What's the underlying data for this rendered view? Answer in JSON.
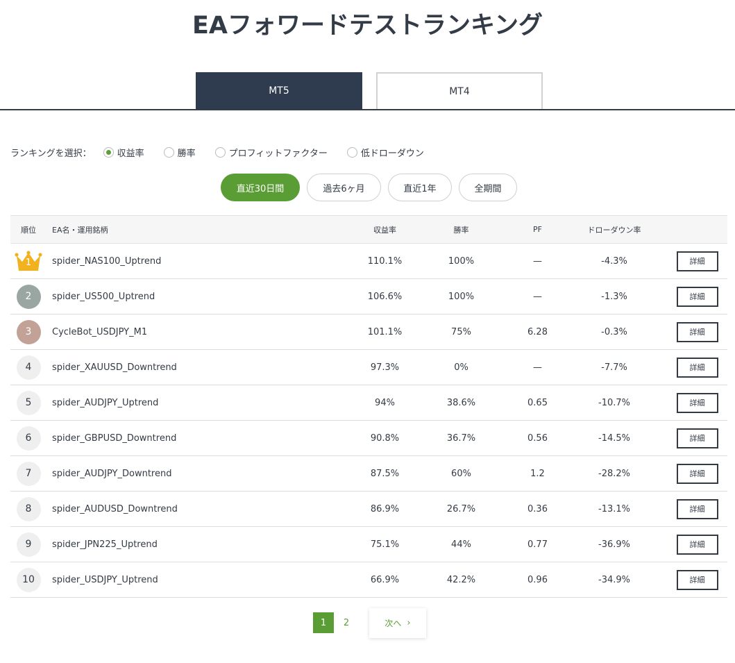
{
  "title": "EAフォワードテストランキング",
  "platform_tabs": [
    {
      "label": "MT5",
      "active": true
    },
    {
      "label": "MT4",
      "active": false
    }
  ],
  "ranking_select": {
    "label": "ランキングを選択：",
    "options": [
      {
        "label": "収益率",
        "checked": true
      },
      {
        "label": "勝率",
        "checked": false
      },
      {
        "label": "プロフィットファクター",
        "checked": false
      },
      {
        "label": "低ドローダウン",
        "checked": false
      }
    ]
  },
  "periods": [
    {
      "label": "直近30日間",
      "active": true
    },
    {
      "label": "過去6ヶ月",
      "active": false
    },
    {
      "label": "直近1年",
      "active": false
    },
    {
      "label": "全期間",
      "active": false
    }
  ],
  "table": {
    "headers": {
      "rank": "順位",
      "name": "EA名・運用銘柄",
      "return": "収益率",
      "win": "勝率",
      "pf": "PF",
      "drawdown": "ドローダウン率"
    },
    "detail_label": "詳細",
    "rows": [
      {
        "rank": "1",
        "name": "spider_NAS100_Uptrend",
        "return": "110.1%",
        "win": "100%",
        "pf": "—",
        "drawdown": "-4.3%"
      },
      {
        "rank": "2",
        "name": "spider_US500_Uptrend",
        "return": "106.6%",
        "win": "100%",
        "pf": "—",
        "drawdown": "-1.3%"
      },
      {
        "rank": "3",
        "name": "CycleBot_USDJPY_M1",
        "return": "101.1%",
        "win": "75%",
        "pf": "6.28",
        "drawdown": "-0.3%"
      },
      {
        "rank": "4",
        "name": "spider_XAUUSD_Downtrend",
        "return": "97.3%",
        "win": "0%",
        "pf": "—",
        "drawdown": "-7.7%"
      },
      {
        "rank": "5",
        "name": "spider_AUDJPY_Uptrend",
        "return": "94%",
        "win": "38.6%",
        "pf": "0.65",
        "drawdown": "-10.7%"
      },
      {
        "rank": "6",
        "name": "spider_GBPUSD_Downtrend",
        "return": "90.8%",
        "win": "36.7%",
        "pf": "0.56",
        "drawdown": "-14.5%"
      },
      {
        "rank": "7",
        "name": "spider_AUDJPY_Downtrend",
        "return": "87.5%",
        "win": "60%",
        "pf": "1.2",
        "drawdown": "-28.2%"
      },
      {
        "rank": "8",
        "name": "spider_AUDUSD_Downtrend",
        "return": "86.9%",
        "win": "26.7%",
        "pf": "0.36",
        "drawdown": "-13.1%"
      },
      {
        "rank": "9",
        "name": "spider_JPN225_Uptrend",
        "return": "75.1%",
        "win": "44%",
        "pf": "0.77",
        "drawdown": "-36.9%"
      },
      {
        "rank": "10",
        "name": "spider_USDJPY_Uptrend",
        "return": "66.9%",
        "win": "42.2%",
        "pf": "0.96",
        "drawdown": "-34.9%"
      }
    ]
  },
  "pagination": {
    "current": "1",
    "other": "2",
    "next_label": "次へ"
  },
  "icons": {
    "crown": "crown-icon",
    "next": "chevron-right-icon"
  },
  "colors": {
    "accent_green": "#5a9d35",
    "tab_dark": "#2f3c50",
    "silver": "#9aa6a1",
    "bronze": "#c2a297",
    "gold": "#f2b21f"
  }
}
